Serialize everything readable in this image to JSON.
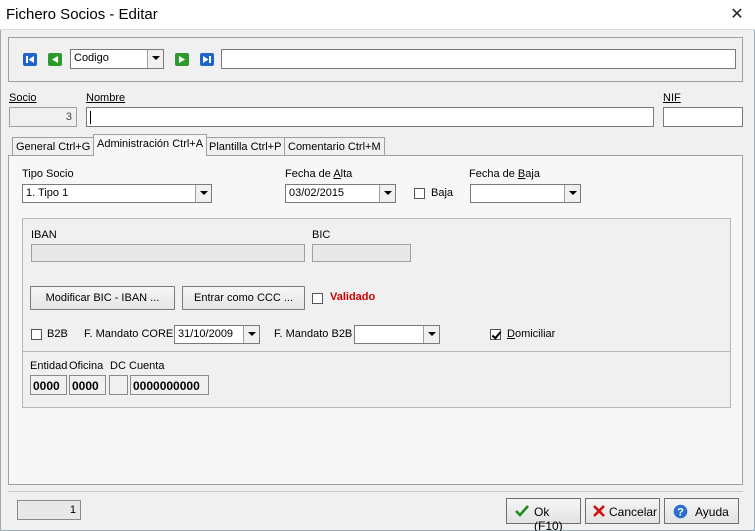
{
  "window": {
    "title": "Fichero Socios - Editar",
    "close_glyph": "✕"
  },
  "nav": {
    "field_select": "Codigo",
    "search_value": "",
    "icons": [
      "first-record-icon",
      "previous-record-icon",
      "next-record-icon",
      "last-record-icon"
    ]
  },
  "header": {
    "socio_label": "Socio",
    "socio_value": "3",
    "nombre_label": "Nombre",
    "nombre_value": "",
    "nif_label": "NIF",
    "nif_value": ""
  },
  "tabs": [
    {
      "label": "General Ctrl+G",
      "active": false
    },
    {
      "label": "Administración Ctrl+A",
      "active": true
    },
    {
      "label": "Plantilla Ctrl+P",
      "active": false
    },
    {
      "label": "Comentario Ctrl+M",
      "active": false
    }
  ],
  "admin": {
    "tipo_socio_label": "Tipo Socio",
    "tipo_socio_value": "1. Tipo 1",
    "fecha_alta_label": "Fecha de Alta",
    "fecha_alta_value": "03/02/2015",
    "baja_label": "Baja",
    "baja_checked": false,
    "fecha_baja_label": "Fecha de Baja",
    "fecha_baja_value": "",
    "iban_label": "IBAN",
    "iban_value": "",
    "bic_label": "BIC",
    "bic_value": "",
    "modificar_button": "Modificar BIC - IBAN ...",
    "entrar_ccc_button": "Entrar como CCC ...",
    "validado_label": "Validado",
    "validado_color": "#cc0000",
    "b2b_label": "B2B",
    "b2b_checked": false,
    "mandato_core_label": "F. Mandato CORE",
    "mandato_core_value": "31/10/2009",
    "mandato_b2b_label": "F. Mandato B2B",
    "mandato_b2b_value": "",
    "domiciliar_label": "Domiciliar",
    "domiciliar_checked": true
  },
  "ccc": {
    "entidad_label": "Entidad",
    "oficina_label": "Oficina",
    "dc_label": "DC",
    "cuenta_label": "Cuenta",
    "entidad_value": "0000",
    "oficina_value": "0000",
    "dc_value": "",
    "cuenta_value": "0000000000"
  },
  "footer": {
    "record_count": "1",
    "ok_label": "Ok (F10)",
    "cancel_label": "Cancelar",
    "help_label": "Ayuda"
  }
}
